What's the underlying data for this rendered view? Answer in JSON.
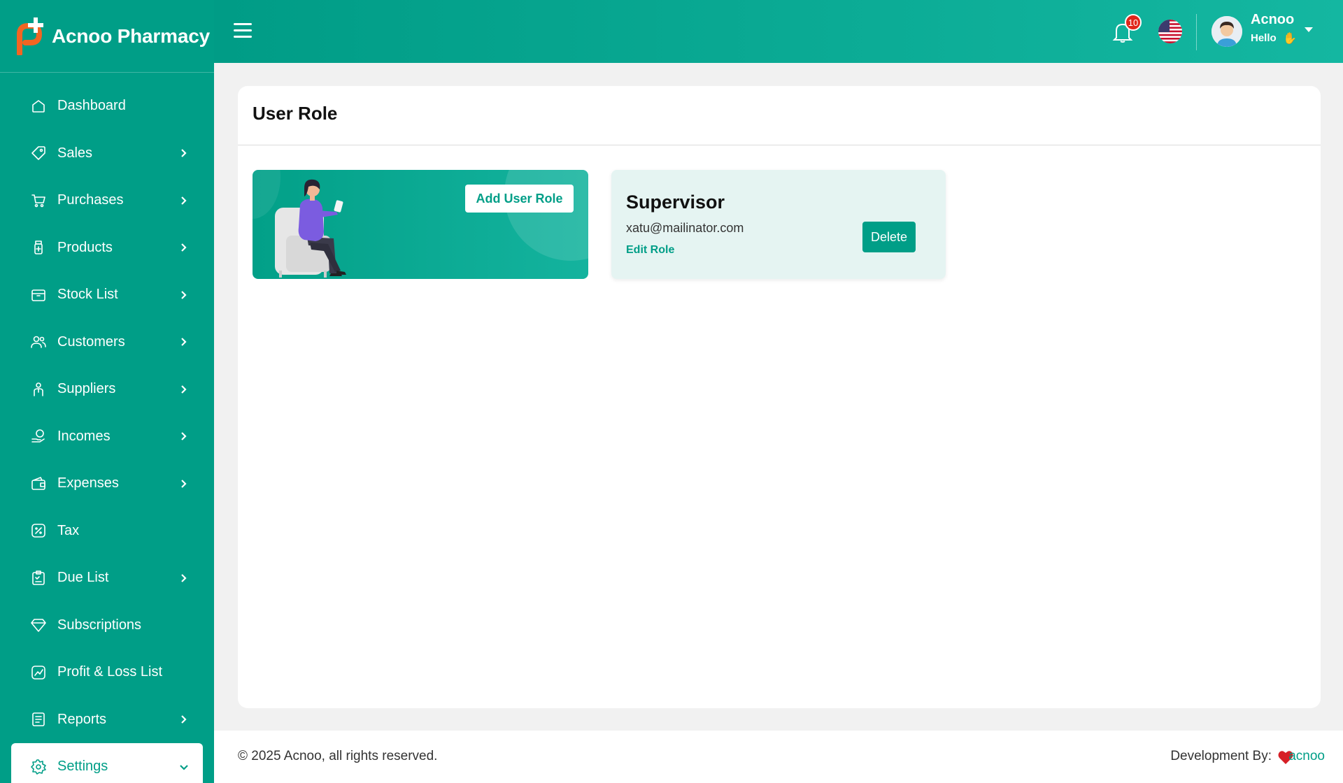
{
  "brand": {
    "name": "Acnoo Pharmacy"
  },
  "sidebar": {
    "items": [
      {
        "label": "Dashboard",
        "icon": "home-icon",
        "has_children": false
      },
      {
        "label": "Sales",
        "icon": "tag-icon",
        "has_children": true
      },
      {
        "label": "Purchases",
        "icon": "cart-icon",
        "has_children": true
      },
      {
        "label": "Products",
        "icon": "medicine-bottle-icon",
        "has_children": true
      },
      {
        "label": "Stock List",
        "icon": "box-icon",
        "has_children": true
      },
      {
        "label": "Customers",
        "icon": "users-icon",
        "has_children": true
      },
      {
        "label": "Suppliers",
        "icon": "supplier-icon",
        "has_children": true
      },
      {
        "label": "Incomes",
        "icon": "coin-hand-icon",
        "has_children": true
      },
      {
        "label": "Expenses",
        "icon": "wallet-icon",
        "has_children": true
      },
      {
        "label": "Tax",
        "icon": "percent-icon",
        "has_children": false
      },
      {
        "label": "Due List",
        "icon": "clipboard-check-icon",
        "has_children": true
      },
      {
        "label": "Subscriptions",
        "icon": "diamond-icon",
        "has_children": false
      },
      {
        "label": "Profit & Loss List",
        "icon": "chart-icon",
        "has_children": false
      },
      {
        "label": "Reports",
        "icon": "report-icon",
        "has_children": true
      },
      {
        "label": "Settings",
        "icon": "gear-icon",
        "has_children": true,
        "active": true
      }
    ]
  },
  "header": {
    "notification_count": "10",
    "user_name": "Acnoo",
    "user_greeting": "Hello",
    "greeting_emoji": "✋"
  },
  "main": {
    "title": "User Role",
    "add_button_label": "Add User Role",
    "roles": [
      {
        "name": "Supervisor",
        "email": "xatu@mailinator.com",
        "edit_label": "Edit Role",
        "delete_label": "Delete"
      }
    ]
  },
  "footer": {
    "copyright": "© 2025 Acnoo, all rights reserved.",
    "dev_label": "Development By:",
    "dev_link": "acnoo"
  },
  "colors": {
    "primary": "#009e87",
    "primary_light": "#14b7a1",
    "badge": "#e1251b",
    "role_card_bg": "#e5f4f2"
  }
}
